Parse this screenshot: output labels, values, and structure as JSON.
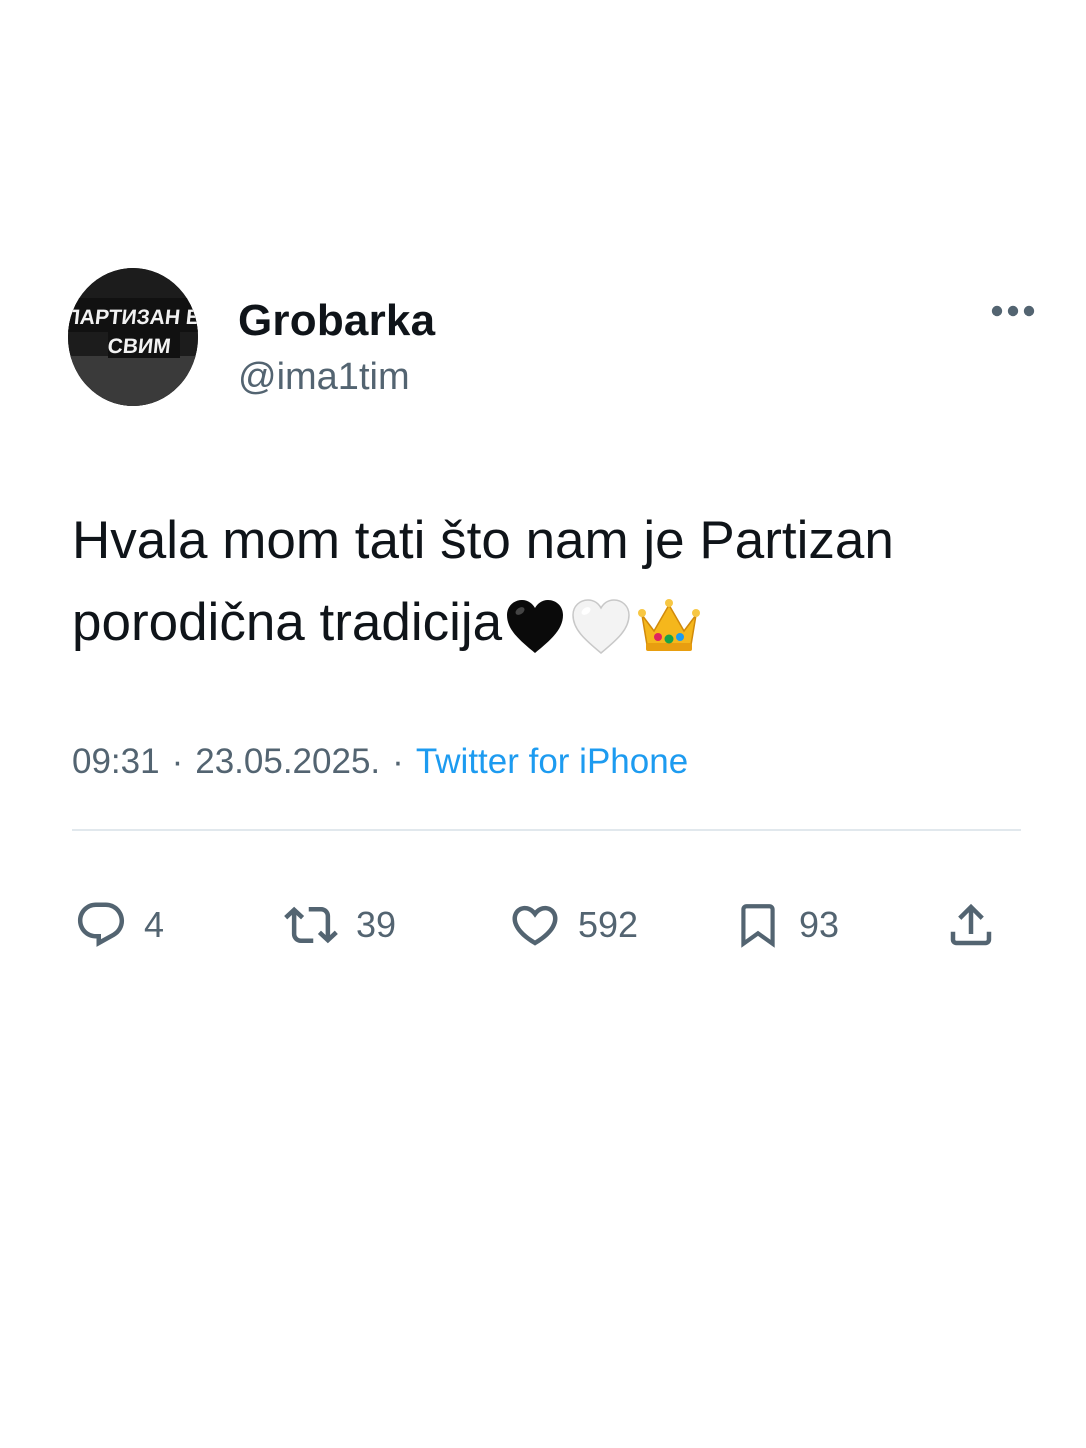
{
  "tweet": {
    "display_name": "Grobarka",
    "handle": "@ima1tim",
    "text_line1": "Hvala mom tati što nam je Partizan",
    "text_line2": "porodična tradicija",
    "time": "09:31",
    "date": "23.05.2025.",
    "separator": "·",
    "source": "Twitter for iPhone",
    "avatar_text_top": "ПАРТИЗАН ЕЗА",
    "avatar_text_bottom": "СВИМ"
  },
  "emojis": [
    "black-heart",
    "white-heart",
    "crown"
  ],
  "actions": {
    "replies": "4",
    "retweets": "39",
    "likes": "592",
    "bookmarks": "93"
  },
  "colors": {
    "text": "#0f1419",
    "secondary": "#536471",
    "link": "#1d9bf0",
    "divider": "#e1e8ed"
  }
}
